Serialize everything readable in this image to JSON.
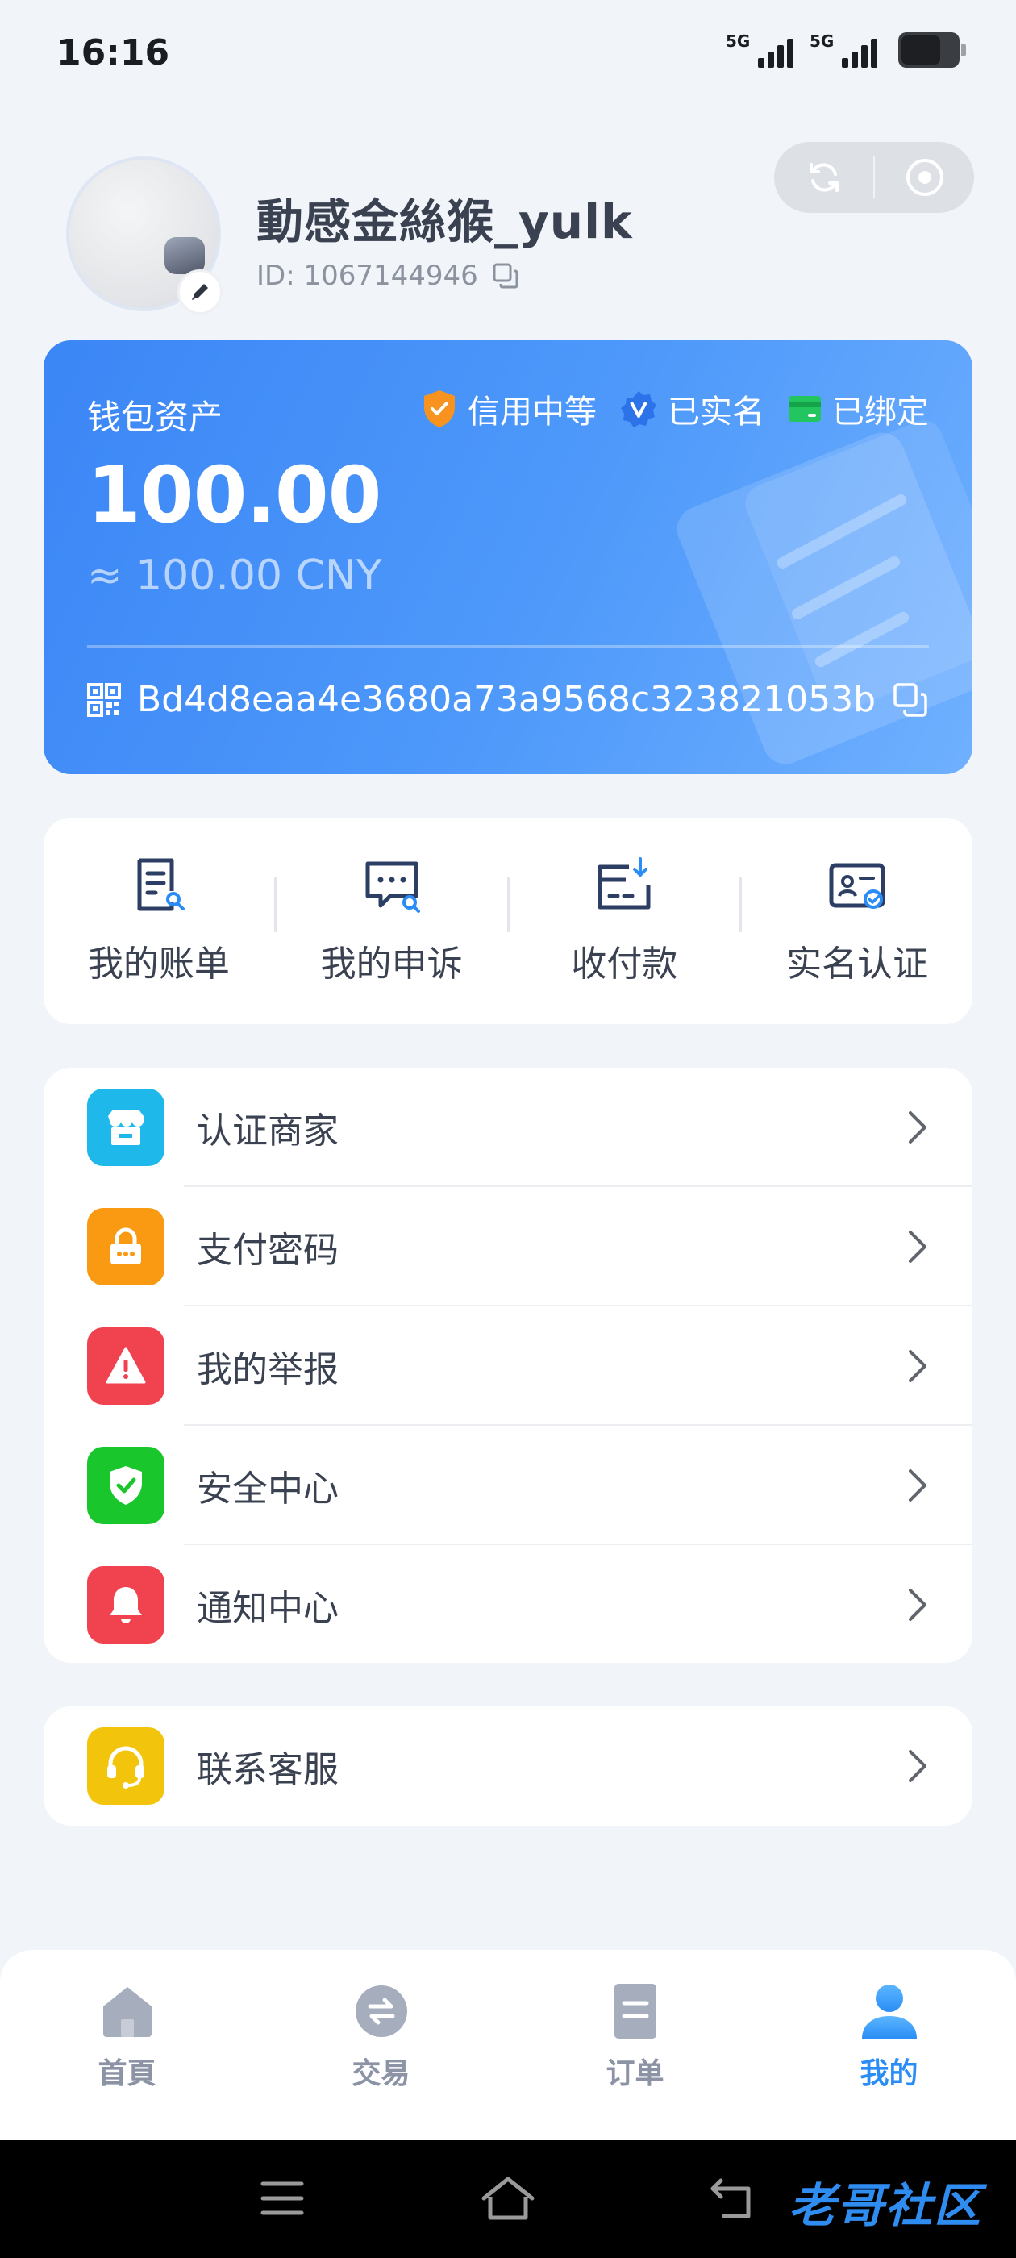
{
  "status_bar": {
    "time": "16:16",
    "network_1": "5G",
    "network_2": "5G"
  },
  "profile": {
    "nickname": "動感金絲猴_yulk",
    "id_text": "ID: 1067144946"
  },
  "wallet": {
    "title": "钱包资产",
    "badges": [
      {
        "label": "信用中等",
        "icon": "shield-check-icon",
        "color": "#f7931e"
      },
      {
        "label": "已实名",
        "icon": "verified-v-icon",
        "color": "#2c72e8"
      },
      {
        "label": "已绑定",
        "icon": "card-icon",
        "color": "#22c55e"
      }
    ],
    "amount": "100.00",
    "cny": "≈ 100.00 CNY",
    "address": "Bd4d8eaa4e3680a73a9568c323821053b"
  },
  "quick_actions": [
    {
      "label": "我的账单",
      "icon": "bill-search-icon"
    },
    {
      "label": "我的申诉",
      "icon": "appeal-chat-icon"
    },
    {
      "label": "收付款",
      "icon": "wallet-download-icon"
    },
    {
      "label": "实名认证",
      "icon": "id-card-check-icon"
    }
  ],
  "menu_main": [
    {
      "label": "认证商家",
      "icon": "store-icon",
      "color": "#1fb8ea"
    },
    {
      "label": "支付密码",
      "icon": "lock-icon",
      "color": "#fa9a12"
    },
    {
      "label": "我的举报",
      "icon": "warning-icon",
      "color": "#f0424f"
    },
    {
      "label": "安全中心",
      "icon": "shield-icon",
      "color": "#19c72d"
    },
    {
      "label": "通知中心",
      "icon": "bell-icon",
      "color": "#f0424f"
    }
  ],
  "menu_support": [
    {
      "label": "联系客服",
      "icon": "headset-icon",
      "color": "#f2c50c"
    }
  ],
  "tabbar": [
    {
      "label": "首頁",
      "icon": "home-icon",
      "active": false
    },
    {
      "label": "交易",
      "icon": "exchange-icon",
      "active": false
    },
    {
      "label": "订单",
      "icon": "order-icon",
      "active": false
    },
    {
      "label": "我的",
      "icon": "user-icon",
      "active": true
    }
  ],
  "watermark": "老哥社区",
  "colors": {
    "accent": "#2a8df6",
    "wallet_gradient_start": "#3b86f6",
    "wallet_gradient_end": "#6fb0ff",
    "background": "#f1f4f9"
  }
}
